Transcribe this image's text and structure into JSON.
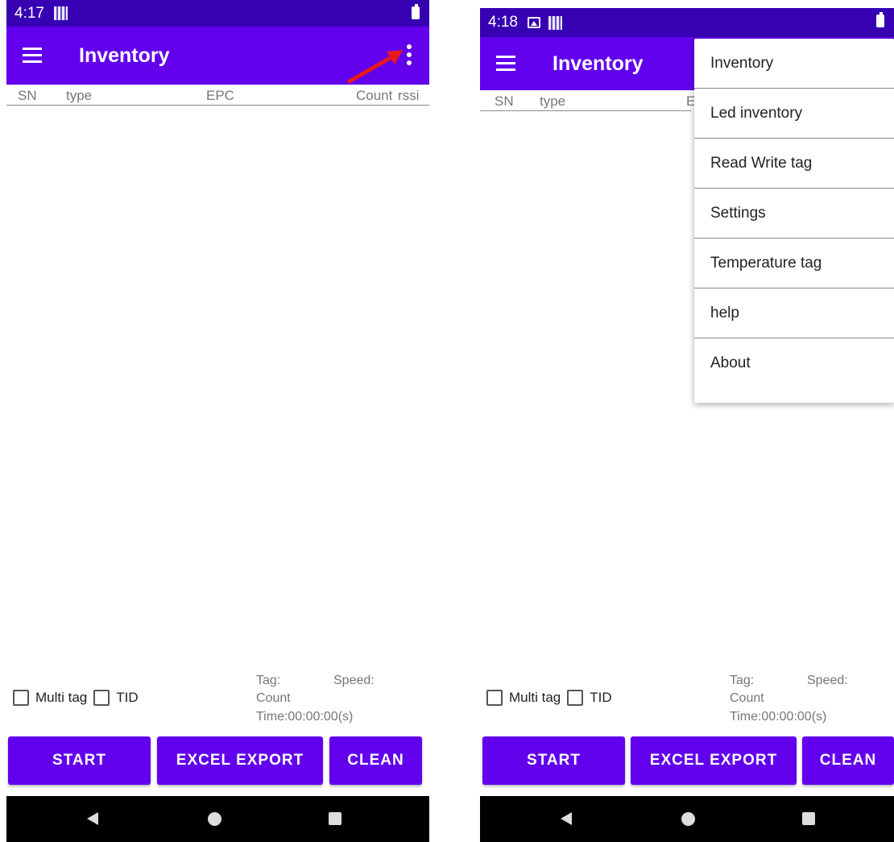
{
  "left": {
    "status": {
      "time": "4:17"
    },
    "app_bar": {
      "title": "Inventory"
    },
    "table": {
      "sn": "SN",
      "type": "type",
      "epc": "EPC",
      "count": "Count",
      "rssi": "rssi"
    },
    "controls": {
      "multi_tag": "Multi tag",
      "tid": "TID",
      "tag": "Tag:",
      "speed": "Speed:",
      "count": "Count",
      "time": "Time:00:00:00(s)"
    },
    "buttons": {
      "start": "START",
      "excel_export": "EXCEL EXPORT",
      "clean": "CLEAN"
    }
  },
  "right": {
    "status": {
      "time": "4:18"
    },
    "app_bar": {
      "title": "Inventory"
    },
    "table": {
      "sn": "SN",
      "type": "type",
      "epc_partial": "E"
    },
    "controls": {
      "multi_tag": "Multi tag",
      "tid": "TID",
      "tag": "Tag:",
      "speed": "Speed:",
      "count": "Count",
      "time": "Time:00:00:00(s)"
    },
    "buttons": {
      "start": "START",
      "excel_export": "EXCEL EXPORT",
      "clean": "CLEAN"
    },
    "menu": {
      "items": [
        "Inventory",
        "Led inventory",
        "Read Write tag",
        "Settings",
        "Temperature tag",
        "help",
        "About"
      ]
    }
  },
  "colors": {
    "status_bar": "#3700b3",
    "primary": "#6200ee",
    "annotation_arrow": "#e8191b"
  }
}
